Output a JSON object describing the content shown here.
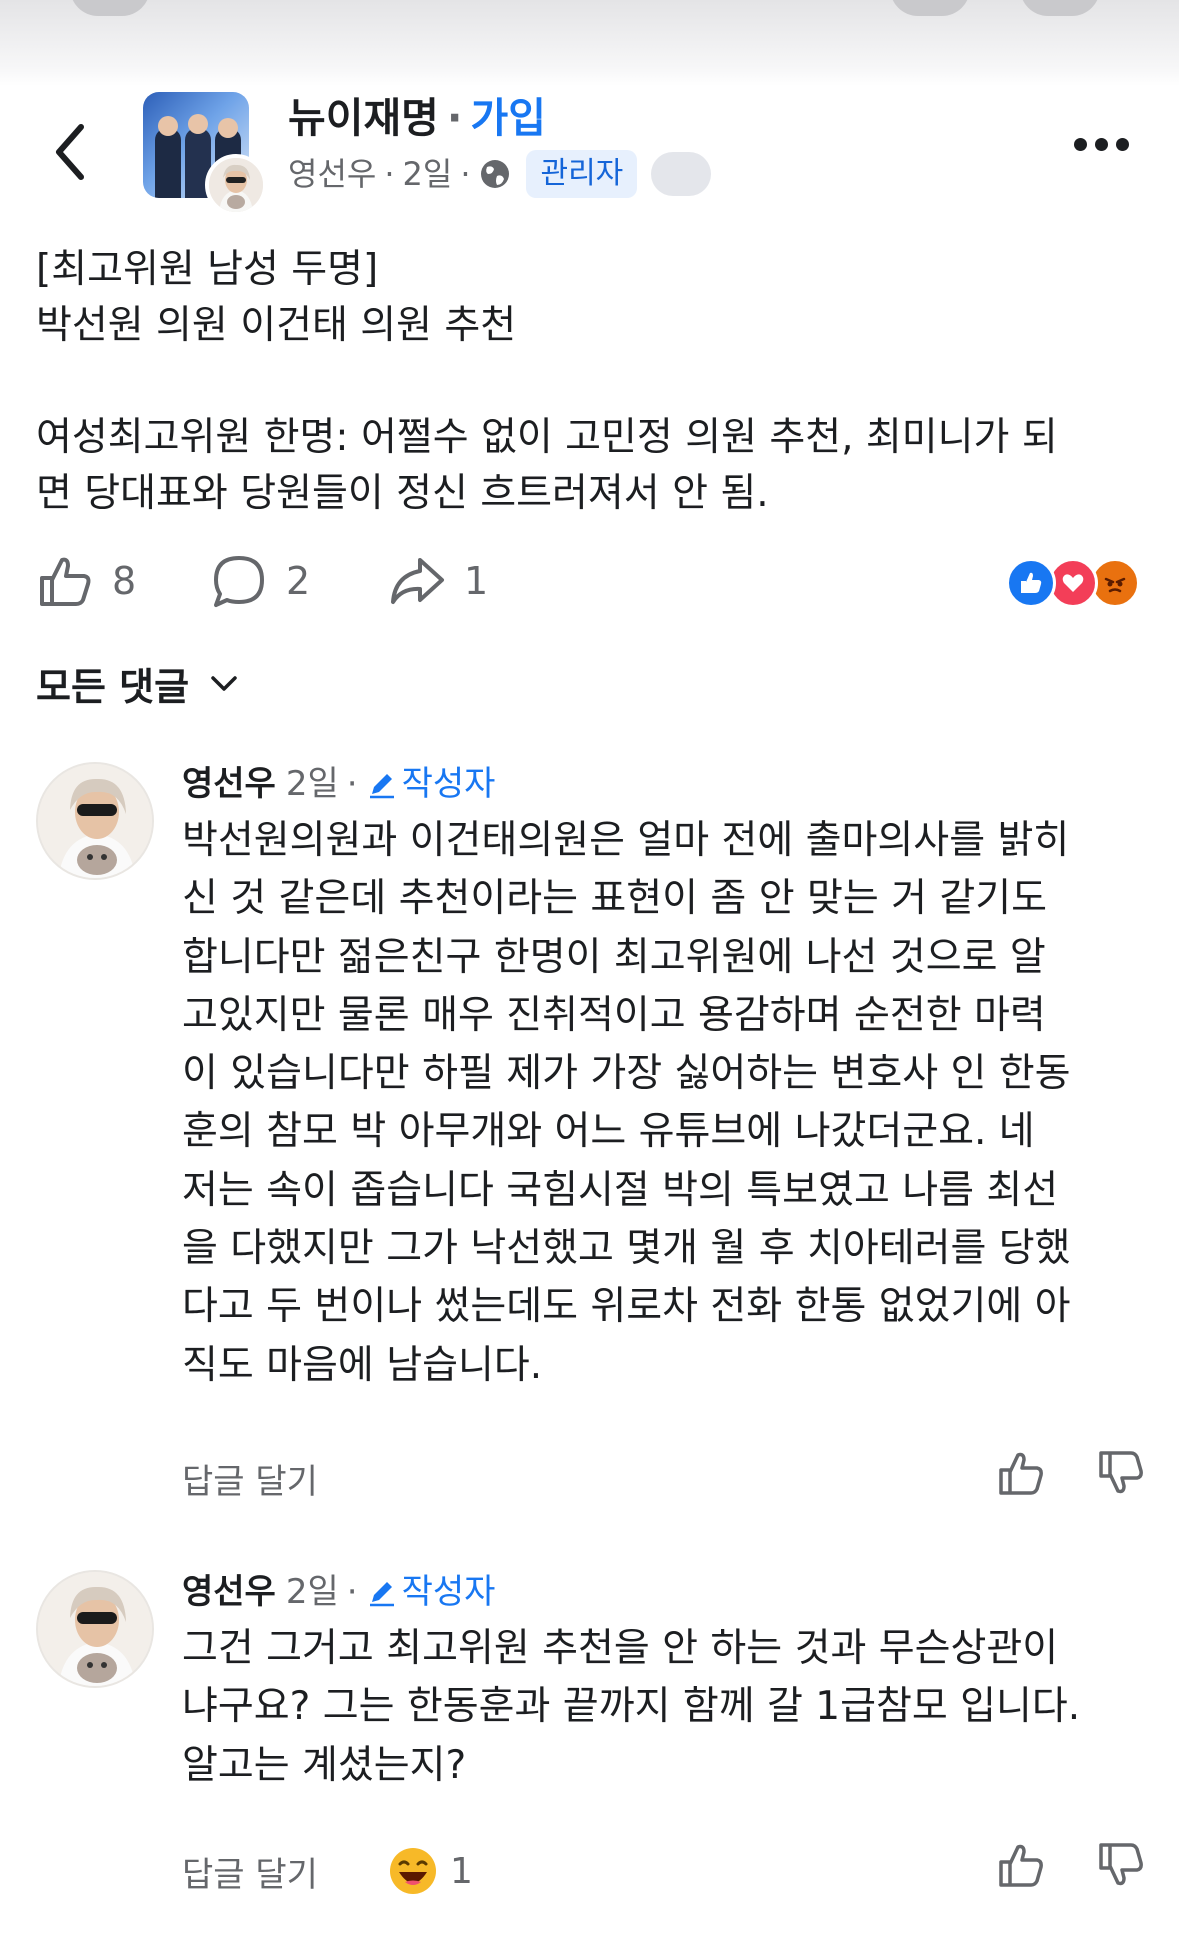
{
  "header": {
    "group_name": "뉴이재명",
    "separator": "·",
    "join_label": "가입",
    "author": "영선우",
    "time": "2일",
    "admin_badge": "관리자"
  },
  "post": {
    "lines": [
      "[최고위원 남성 두명]",
      "박선원 의원 이건태 의원 추천",
      "",
      "여성최고위원 한명: 어쩔수 없이 고민정 의원 추천, 최미니가 되",
      "면 당대표와 당원들이 정신 흐트러져서 안 됨."
    ]
  },
  "actions": {
    "like_count": "8",
    "comment_count": "2",
    "share_count": "1",
    "reaction_icons": [
      "like",
      "love",
      "angry"
    ]
  },
  "comments_section": {
    "sort_label": "모든 댓글"
  },
  "comments": [
    {
      "author": "영선우",
      "time": "2일",
      "author_tag": "작성자",
      "lines": [
        "박선원의원과 이건태의원은 얼마 전에 출마의사를 밝히",
        "신 것 같은데 추천이라는 표현이 좀 안 맞는 거 같기도",
        "합니다만 젊은친구 한명이 최고위원에 나선 것으로 알",
        "고있지만 물론 매우 진취적이고 용감하며 순전한 마력",
        "이 있습니다만 하필 제가 가장 싫어하는 변호사 인 한동",
        "훈의 참모 박 아무개와 어느 유튜브에 나갔더군요. 네",
        "저는 속이 좁습니다 국힘시절 박의 특보였고 나름 최선",
        "을 다했지만 그가 낙선했고 몇개 월 후 치아테러를 당했",
        "다고 두 번이나 썼는데도 위로차 전화 한통 없었기에 아",
        "직도 마음에 남습니다."
      ],
      "reply_label": "답글 달기"
    },
    {
      "author": "영선우",
      "time": "2일",
      "author_tag": "작성자",
      "lines": [
        "그건 그거고 최고위원 추천을 안 하는 것과 무슨상관이",
        "냐구요? 그는 한동훈과 끝까지 함께 갈 1급참모 입니다.",
        "알고는 계셨는지?"
      ],
      "reply_label": "답글 달기",
      "reaction_count": "1",
      "reaction_icon": "laughing"
    }
  ]
}
